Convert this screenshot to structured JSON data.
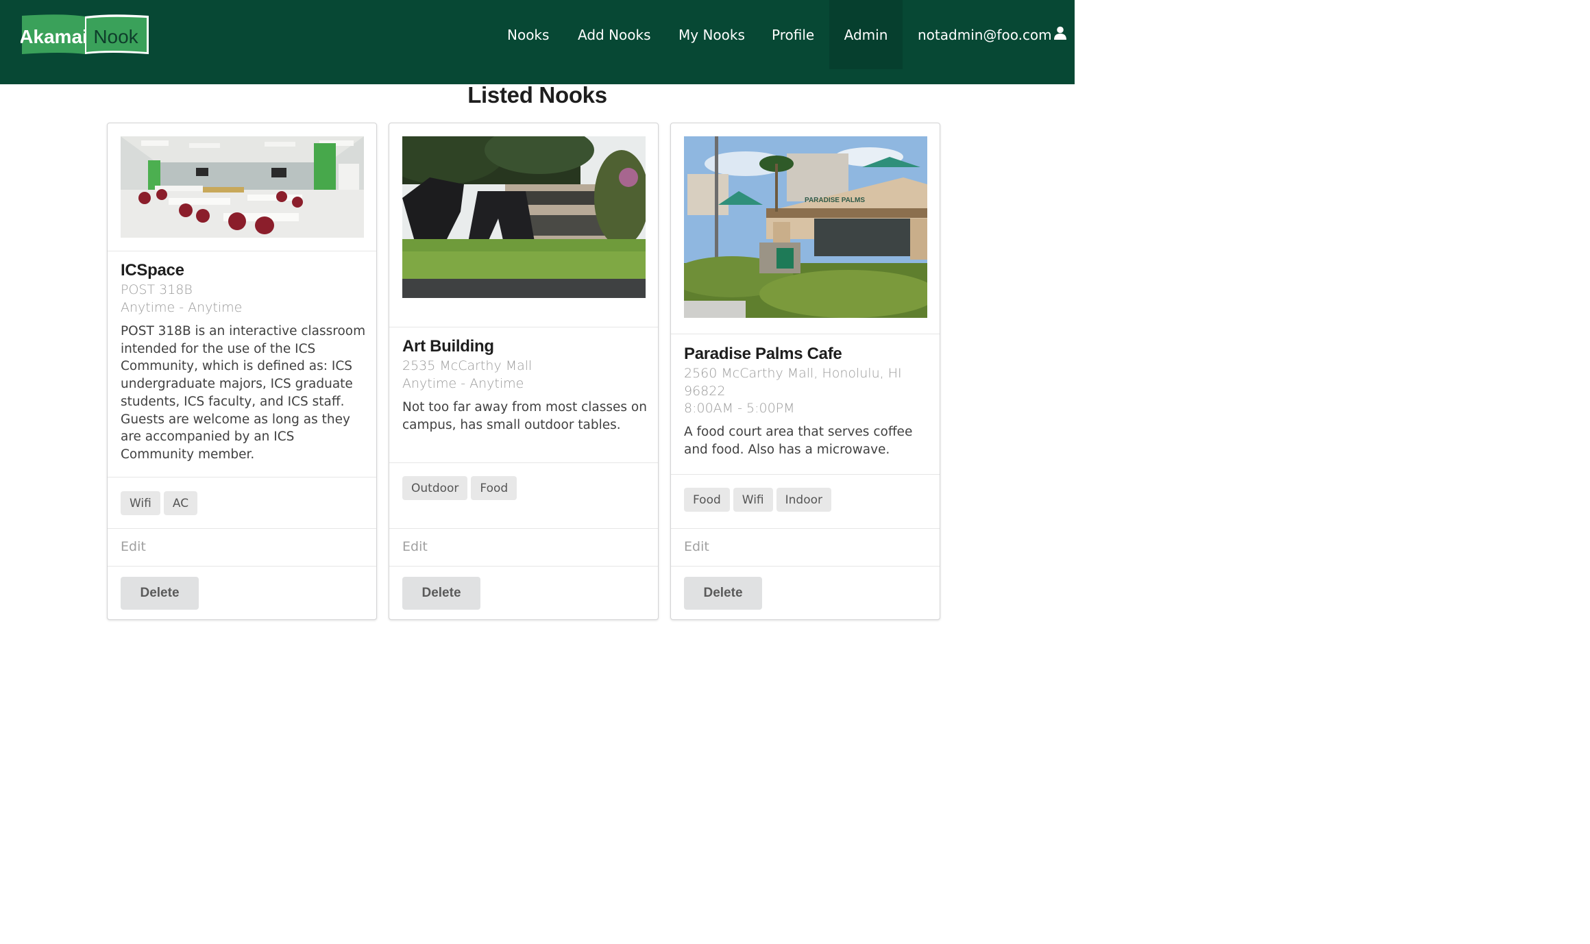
{
  "navbar": {
    "logo": {
      "word1": "Akamai",
      "word2": "Nook"
    },
    "items": [
      {
        "label": "Nooks"
      },
      {
        "label": "Add Nooks"
      },
      {
        "label": "My Nooks"
      },
      {
        "label": "Profile"
      },
      {
        "label": "Admin"
      }
    ],
    "user": "notadmin@foo.com",
    "user_icon": "user-icon",
    "colors": {
      "background": "#074834",
      "active": "#063f2e",
      "logo_green": "#3aa15a"
    }
  },
  "page": {
    "title": "Listed Nooks"
  },
  "cards": [
    {
      "name": "ICSpace",
      "location": "POST 318B",
      "hours": "Anytime - Anytime",
      "description": "POST 318B is an interactive classroom intended for the use of the ICS Community, which is defined as: ICS undergraduate majors, ICS graduate students, ICS faculty, and ICS staff. Guests are welcome as long as they are accompanied by an ICS Community member.",
      "tags": [
        "Wifi",
        "AC"
      ],
      "edit_label": "Edit",
      "delete_label": "Delete"
    },
    {
      "name": "Art Building",
      "location": "2535 McCarthy Mall",
      "hours": "Anytime - Anytime",
      "description": "Not too far away from most classes on campus, has small outdoor tables.",
      "tags": [
        "Outdoor",
        "Food"
      ],
      "edit_label": "Edit",
      "delete_label": "Delete"
    },
    {
      "name": "Paradise Palms Cafe",
      "location": "2560 McCarthy Mall, Honolulu, HI 96822",
      "hours": "8:00AM - 5:00PM",
      "description": "A food court area that serves coffee and food. Also has a microwave.",
      "tags": [
        "Food",
        "Wifi",
        "Indoor"
      ],
      "edit_label": "Edit",
      "delete_label": "Delete",
      "sign_text": "PARADISE PALMS"
    }
  ]
}
